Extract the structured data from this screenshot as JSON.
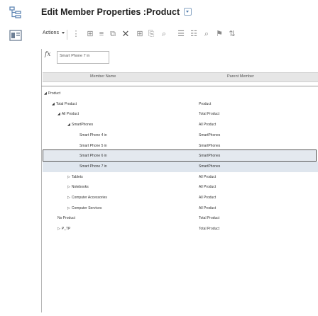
{
  "title": {
    "text": "Edit Member Properties :Product"
  },
  "toolbar": {
    "actions_label": "Actions",
    "icons": [
      "filter-icon",
      "expand-icon",
      "list-icon",
      "cut-icon",
      "delete-icon",
      "grid-icon",
      "copy-icon",
      "search-icon",
      "align-left-icon",
      "align-center-icon",
      "search-plus-icon",
      "flag-icon",
      "sort-icon"
    ]
  },
  "formula_bar": {
    "fx": "fx",
    "value": "Smart Phone 7 in"
  },
  "columns": {
    "member_name": "Member Name",
    "parent_member": "Parent Member"
  },
  "rows": [
    {
      "member": "Product",
      "parent": "",
      "indent": 0,
      "tri": "◢"
    },
    {
      "member": "Total Product",
      "parent": "Product",
      "indent": 1,
      "tri": "◢"
    },
    {
      "member": "All Product",
      "parent": "Total Product",
      "indent": 2,
      "tri": "◢"
    },
    {
      "member": "SmartPhones",
      "parent": "All Product",
      "indent": 3,
      "tri": "◢"
    },
    {
      "member": "Smart Phone 4 in",
      "parent": "SmartPhones",
      "indent": 4,
      "tri": ""
    },
    {
      "member": "Smart Phone 5 in",
      "parent": "SmartPhones",
      "indent": 4,
      "tri": ""
    },
    {
      "member": "Smart Phone 6 in",
      "parent": "SmartPhones",
      "indent": 4,
      "tri": ""
    },
    {
      "member": "Smart Phone 7 in",
      "parent": "SmartPhones",
      "indent": 4,
      "tri": "",
      "selected": true
    },
    {
      "member": "Tablets",
      "parent": "All Product",
      "indent": 3,
      "tri": "▷"
    },
    {
      "member": "Notebooks",
      "parent": "All Product",
      "indent": 3,
      "tri": "▷"
    },
    {
      "member": "Computer Accessories",
      "parent": "All Product",
      "indent": 3,
      "tri": "▷"
    },
    {
      "member": "Computer Services",
      "parent": "All Product",
      "indent": 3,
      "tri": "▷"
    },
    {
      "member": "No Product",
      "parent": "Total Product",
      "indent": 2,
      "tri": ""
    },
    {
      "member": "P_TP",
      "parent": "Total Product",
      "indent": 2,
      "tri": "▷"
    }
  ]
}
